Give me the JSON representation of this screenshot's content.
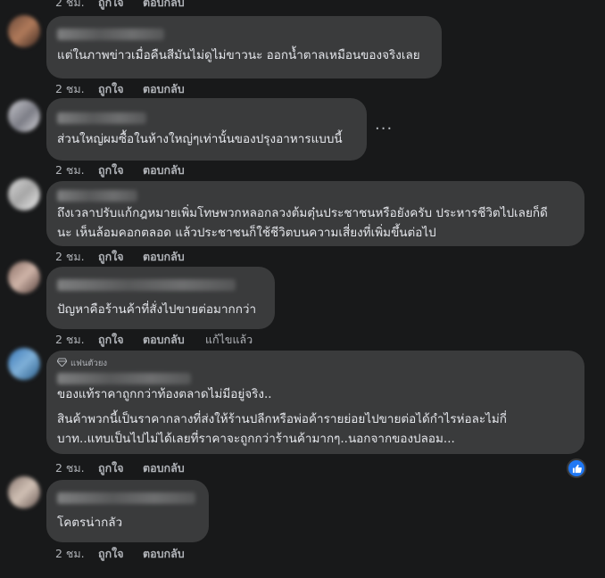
{
  "actions": {
    "time": "2 ชม.",
    "like": "ถูกใจ",
    "reply": "ตอบกลับ",
    "edited": "แก้ไขแล้ว"
  },
  "comments": [
    {
      "text": "แต่ในภาพข่าวเมื่อคืนสีมันไม่ดูไม่ขาวนะ ออกน้ำตาลเหมือนของจริงเลย"
    },
    {
      "text": "ส่วนใหญ่ผมซื้อในห้างใหญ่ๆเท่านั้นของปรุงอาหารแบบนี้"
    },
    {
      "text": "ถึงเวลาปรับแก้กฎหมายเพิ่มโทษพวกหลอกลวงต้มตุ๋นประชาชนหรือยังครับ ประหารชีวิตไปเลยก็ดี\nนะ เห็นล้อมคอกตลอด แล้วประชาชนก็ใช้ชีวิตบนความเสี่ยงที่เพิ่มขึ้นต่อไป"
    },
    {
      "text": "ปัญหาคือร้านค้าที่สั่งไปขายต่อมากกว่า"
    },
    {
      "badge": "แฟนตัวยง",
      "line1": "ของแท้ราคาถูกกว่าท้องตลาดไม่มีอยู่จริง..",
      "line2": "สินค้าพวกนี้เป็นราคากลางที่ส่งให้ร้านปลีกหรือพ่อค้ารายย่อยไปขายต่อได้กำไรห่อละไม่กี่\nบาท..แทบเป็นไปไม่ได้เลยที่ราคาจะถูกกว่าร้านค้ามากๆ..นอกจากของปลอม..."
    },
    {
      "text": "โคตรน่ากลัว"
    }
  ],
  "more_label": "···"
}
